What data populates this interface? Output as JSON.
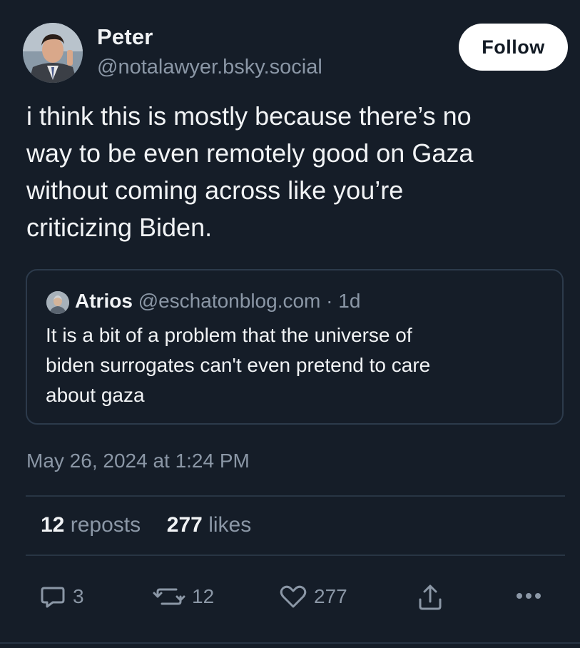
{
  "author": {
    "display_name": "Peter",
    "handle": "@notalawyer.bsky.social"
  },
  "follow_label": "Follow",
  "post_text": "i think this is mostly because there’s no\nway to be even remotely good on Gaza\nwithout coming across like you’re\ncriticizing Biden.",
  "quote": {
    "name": "Atrios",
    "handle": "@eschatonblog.com",
    "separator": "·",
    "time": "1d",
    "text": "It is a bit of a problem that the universe of\nbiden surrogates can't even pretend to care\nabout gaza"
  },
  "timestamp": "May 26, 2024 at 1:24 PM",
  "stats": {
    "reposts_count": "12",
    "reposts_label": "reposts",
    "likes_count": "277",
    "likes_label": "likes"
  },
  "actions": {
    "reply_count": "3",
    "repost_count": "12",
    "like_count": "277",
    "reply_icon": "speech-bubble",
    "repost_icon": "repost-arrows",
    "like_icon": "heart",
    "share_icon": "share-up-arrow",
    "more_icon": "ellipsis"
  },
  "colors": {
    "background": "#151d28",
    "text": "#f1f3f5",
    "muted": "#8b97a6",
    "border": "#2c3a4b",
    "button_bg": "#ffffff"
  }
}
